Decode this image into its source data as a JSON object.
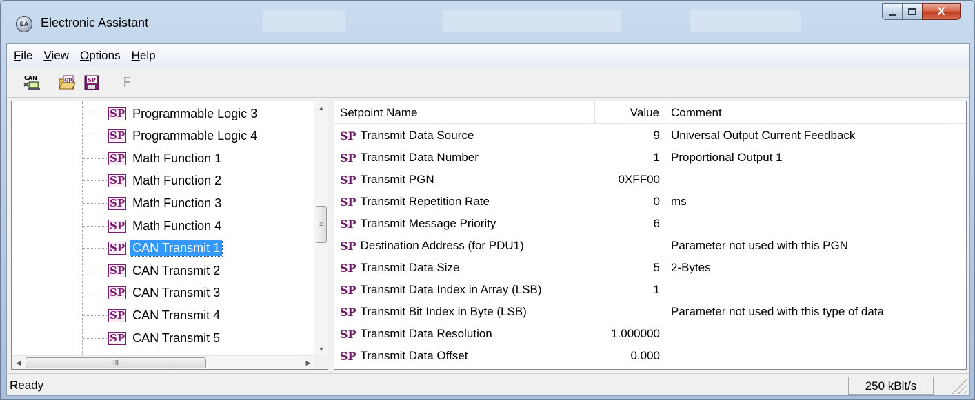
{
  "window": {
    "title": "Electronic Assistant",
    "icon": "ea-app-icon",
    "icon_text": "EA",
    "close_glyph": "X"
  },
  "menu": [
    {
      "label": "File",
      "accel": "F",
      "rest": "ile"
    },
    {
      "label": "View",
      "accel": "V",
      "rest": "iew"
    },
    {
      "label": "Options",
      "accel": "O",
      "rest": "ptions"
    },
    {
      "label": "Help",
      "accel": "H",
      "rest": "elp"
    }
  ],
  "toolbar": {
    "can_icon_text": "CAN",
    "open_sp_icon_text": "SP",
    "save_sp_icon_text": "SP",
    "flash_label": "F"
  },
  "tree": {
    "items": [
      {
        "badge": "SP",
        "label": "Programmable Logic 3"
      },
      {
        "badge": "SP",
        "label": "Programmable Logic 4"
      },
      {
        "badge": "SP",
        "label": "Math Function 1"
      },
      {
        "badge": "SP",
        "label": "Math Function 2"
      },
      {
        "badge": "SP",
        "label": "Math Function 3"
      },
      {
        "badge": "SP",
        "label": "Math Function 4"
      },
      {
        "badge": "SP",
        "label": "CAN Transmit 1",
        "selected": true
      },
      {
        "badge": "SP",
        "label": "CAN Transmit 2"
      },
      {
        "badge": "SP",
        "label": "CAN Transmit 3"
      },
      {
        "badge": "SP",
        "label": "CAN Transmit 4"
      },
      {
        "badge": "SP",
        "label": "CAN Transmit 5"
      }
    ],
    "hscroll_grip": "III",
    "vscroll_grip": "≡"
  },
  "table": {
    "columns": {
      "name": "Setpoint Name",
      "value": "Value",
      "comment": "Comment"
    },
    "rows": [
      {
        "prefix": "SP",
        "name": "Transmit Data Source",
        "value": "9",
        "comment": "Universal Output Current Feedback"
      },
      {
        "prefix": "SP",
        "name": "Transmit Data Number",
        "value": "1",
        "comment": "Proportional Output 1"
      },
      {
        "prefix": "SP",
        "name": "Transmit PGN",
        "value": "0XFF00",
        "comment": ""
      },
      {
        "prefix": "SP",
        "name": "Transmit Repetition Rate",
        "value": "0",
        "comment": "ms"
      },
      {
        "prefix": "SP",
        "name": "Transmit Message Priority",
        "value": "6",
        "comment": ""
      },
      {
        "prefix": "SP",
        "name": "Destination Address (for PDU1)",
        "value": "",
        "comment": "Parameter not used with this PGN"
      },
      {
        "prefix": "SP",
        "name": "Transmit Data Size",
        "value": "5",
        "comment": "2-Bytes"
      },
      {
        "prefix": "SP",
        "name": "Transmit Data Index in Array (LSB)",
        "value": "1",
        "comment": ""
      },
      {
        "prefix": "SP",
        "name": "Transmit Bit Index in Byte (LSB)",
        "value": "",
        "comment": "Parameter not used with this type of data"
      },
      {
        "prefix": "SP",
        "name": "Transmit Data Resolution",
        "value": "1.000000",
        "comment": ""
      },
      {
        "prefix": "SP",
        "name": "Transmit Data Offset",
        "value": "0.000",
        "comment": ""
      }
    ]
  },
  "status": {
    "text": "Ready",
    "baud": "250 kBit/s"
  },
  "colors": {
    "selection": "#3399ff",
    "sp_badge": "#7a1e6e",
    "close_button": "#c13c1f"
  }
}
